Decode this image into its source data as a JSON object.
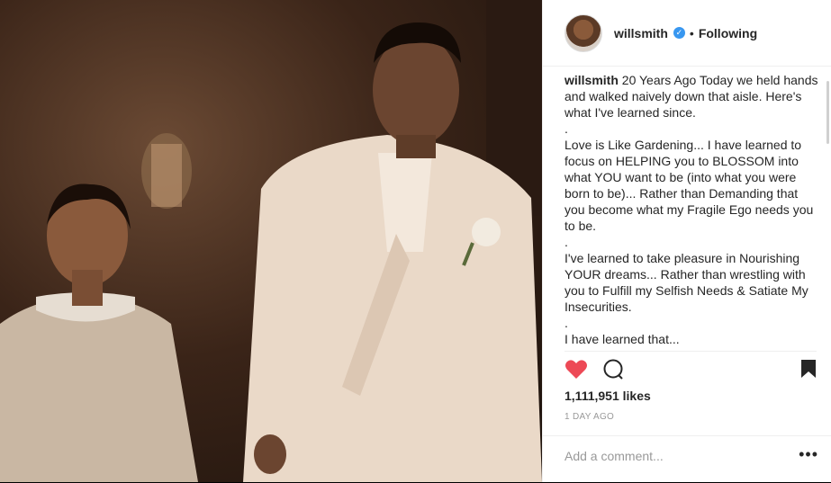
{
  "header": {
    "username": "willsmith",
    "separator": "•",
    "follow_status": "Following"
  },
  "caption": {
    "username": "willsmith",
    "lines": [
      " 20 Years Ago Today we held hands and walked naively down that aisle. Here's what I've learned since.",
      ".",
      "Love is Like Gardening... I have learned to focus on HELPING you to BLOSSOM into what YOU want to be (into what you were born to be)... Rather than Demanding that you become what my Fragile Ego needs you to be.",
      ".",
      "I've learned to take pleasure in Nourishing YOUR dreams... Rather than wrestling with you to Fulfill my Selfish Needs & Satiate My Insecurities.",
      ".",
      "I have learned that..."
    ]
  },
  "actions": {
    "like_icon": "heart-filled-icon",
    "comment_icon": "comment-bubble-icon",
    "save_icon": "bookmark-icon",
    "like_color": "#ed4956"
  },
  "stats": {
    "likes": "1,111,951 likes",
    "time_ago": "1 DAY AGO"
  },
  "comment": {
    "placeholder": "Add a comment...",
    "more_label": "•••"
  },
  "photo": {
    "description_icon": "wedding-photo"
  }
}
